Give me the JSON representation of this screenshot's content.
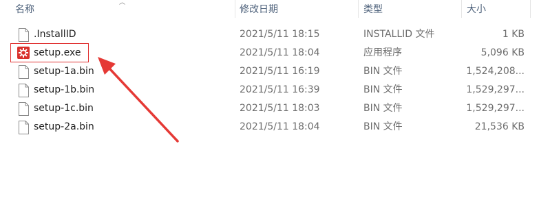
{
  "columns": {
    "name": "名称",
    "date": "修改日期",
    "type": "类型",
    "size": "大小"
  },
  "files": [
    {
      "name": ".InstallID",
      "date": "2021/5/11 18:15",
      "type": "INSTALLID 文件",
      "size": "1 KB",
      "icon": "blank-file-icon"
    },
    {
      "name": "setup.exe",
      "date": "2021/5/11 18:04",
      "type": "应用程序",
      "size": "5,096 KB",
      "icon": "setup-app-icon"
    },
    {
      "name": "setup-1a.bin",
      "date": "2021/5/11 16:19",
      "type": "BIN 文件",
      "size": "1,524,208...",
      "icon": "blank-file-icon"
    },
    {
      "name": "setup-1b.bin",
      "date": "2021/5/11 16:39",
      "type": "BIN 文件",
      "size": "1,529,297...",
      "icon": "blank-file-icon"
    },
    {
      "name": "setup-1c.bin",
      "date": "2021/5/11 18:03",
      "type": "BIN 文件",
      "size": "1,529,297...",
      "icon": "blank-file-icon"
    },
    {
      "name": "setup-2a.bin",
      "date": "2021/5/11 18:04",
      "type": "BIN 文件",
      "size": "21,536 KB",
      "icon": "blank-file-icon"
    }
  ],
  "annotation": {
    "color": "#e53935"
  }
}
